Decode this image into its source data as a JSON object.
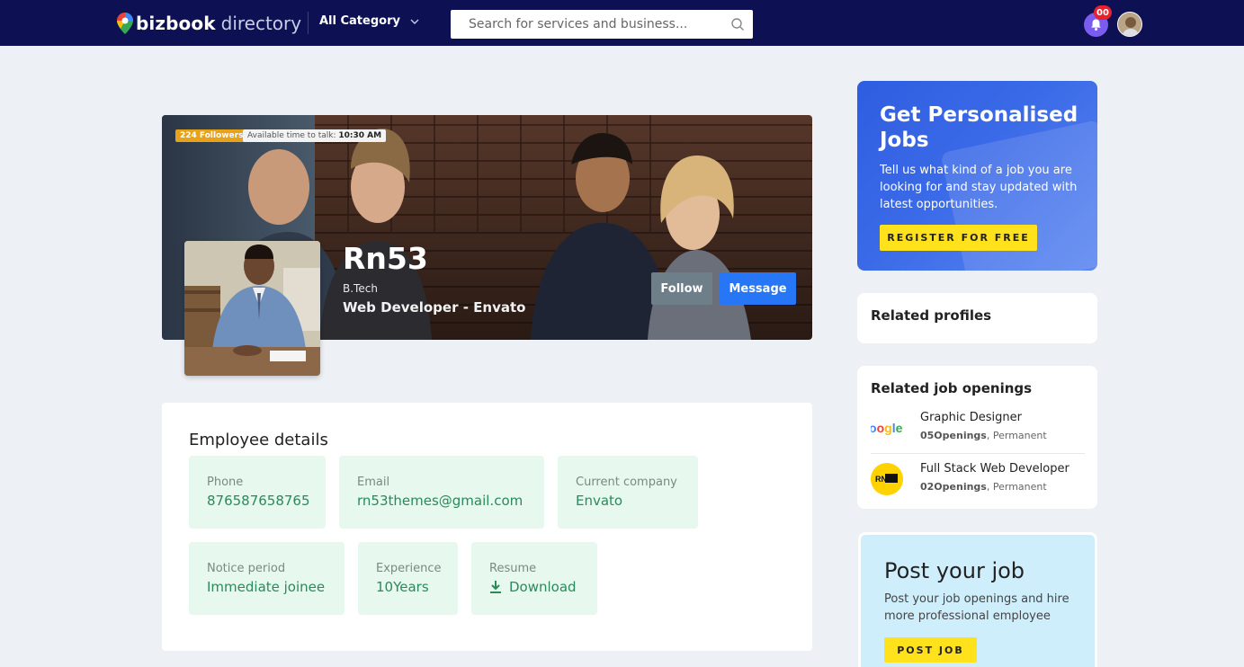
{
  "header": {
    "brand": "bizbook",
    "brand_suffix": "directory",
    "category_label": "All Category",
    "search_placeholder": "Search for services and business...",
    "notification_count": "00"
  },
  "cover": {
    "followers_badge": "224 Followers",
    "available_prefix": "Available time to talk:",
    "available_time": "10:30 AM",
    "name": "Rn53",
    "degree": "B.Tech",
    "role": "Web Developer - Envato",
    "follow_label": "Follow",
    "message_label": "Message"
  },
  "details": {
    "title": "Employee details",
    "fields": [
      {
        "label": "Phone",
        "value": "876587658765"
      },
      {
        "label": "Email",
        "value": "rn53themes@gmail.com"
      },
      {
        "label": "Current company",
        "value": "Envato"
      },
      {
        "label": "Notice period",
        "value": "Immediate joinee"
      },
      {
        "label": "Experience",
        "value": "10Years"
      },
      {
        "label": "Resume",
        "value": "Download"
      }
    ]
  },
  "sidebar": {
    "promo": {
      "title": "Get Personalised Jobs",
      "text": "Tell us what kind of a job you are looking for and stay updated with latest opportunities.",
      "button": "REGISTER FOR FREE"
    },
    "related_profiles_title": "Related profiles",
    "related_jobs_title": "Related job openings",
    "jobs": [
      {
        "title": "Graphic Designer",
        "openings": "05Openings",
        "type": ", Permanent",
        "logo": "google-logo"
      },
      {
        "title": "Full Stack Web Developer",
        "openings": "02Openings",
        "type": ", Permanent",
        "logo": "rn53-logo"
      }
    ],
    "post_job": {
      "title": "Post your job",
      "text": "Post your job openings and hire more professional employee",
      "button": "POST JOB"
    }
  },
  "colors": {
    "topbar": "#0d1154",
    "accent_blue": "#2676f5",
    "badge_orange": "#e8a21a",
    "tile_green_bg": "#e7f8ef",
    "tile_green_text": "#2a8a5a",
    "cta_yellow": "#ffe21c"
  }
}
